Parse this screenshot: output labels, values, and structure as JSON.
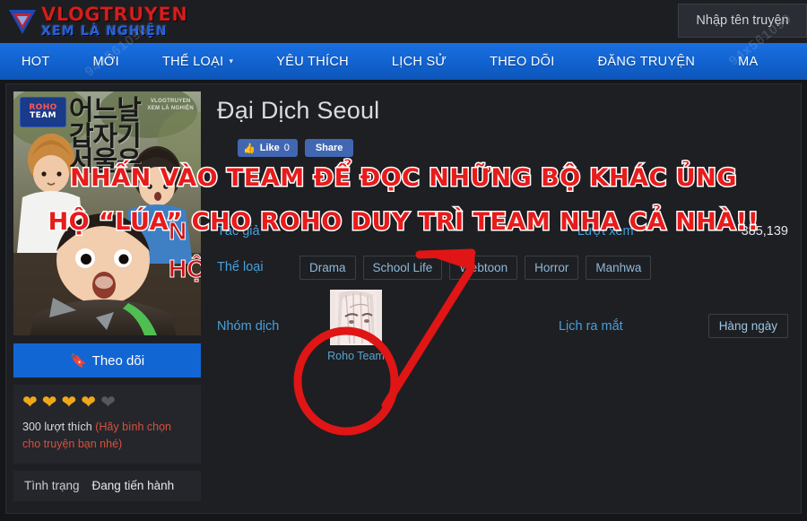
{
  "site": {
    "logo_main": "VLOGTRUYEN",
    "logo_sub": "XEM LÀ NGHIỆN",
    "watermark": "94x561090"
  },
  "search": {
    "placeholder": "Nhập tên truyện",
    "value": ""
  },
  "nav": {
    "items": [
      {
        "label": "HOT",
        "has_caret": false
      },
      {
        "label": "MỚI",
        "has_caret": false
      },
      {
        "label": "THỂ LOẠI",
        "has_caret": true
      },
      {
        "label": "YÊU THÍCH",
        "has_caret": false
      },
      {
        "label": "LỊCH SỬ",
        "has_caret": false
      },
      {
        "label": "THEO DÕI",
        "has_caret": false
      },
      {
        "label": "ĐĂNG TRUYỆN",
        "has_caret": false
      },
      {
        "label": "MA",
        "has_caret": false
      }
    ]
  },
  "cover": {
    "team_badge_line1": "ROHO",
    "team_badge_line2": "TEAM",
    "korean_title": "어느날\n갑자기\n서울은",
    "watermark_line1": "VLOGTRUYEN",
    "watermark_line2": "XEM LÀ NGHIỆN",
    "red_text_line1": "N",
    "red_text_line2": "HỘ"
  },
  "sidebar": {
    "follow_label": "Theo dõi",
    "follow_icon": "bookmark-icon",
    "rating": {
      "filled": 4,
      "total": 5
    },
    "like_count_text": "300 lượt thích",
    "like_hint_text": "(Hãy bình chọn cho truyện bạn nhé)",
    "status_label": "Tình trạng",
    "status_value": "Đang tiến hành"
  },
  "detail": {
    "title": "Đại Dịch Seoul",
    "social": {
      "like_label": "Like",
      "like_count": "0",
      "share_label": "Share"
    },
    "author_label": "Tác giả",
    "author_value": "",
    "views_label": "Lượt xem",
    "views_value": "385,139",
    "genre_label": "Thể loại",
    "genres": [
      "Drama",
      "School Life",
      "Webtoon",
      "Horror",
      "Manhwa"
    ],
    "team_label": "Nhóm dịch",
    "team_name": "Roho Team",
    "schedule_label": "Lịch ra mắt",
    "schedule_value": "Hàng ngày"
  },
  "annotation": {
    "line1": "NHẤN VÀO TEAM ĐỂ ĐỌC NHỮNG BỘ KHÁC ỦNG",
    "line2": "HỘ “LÚA” CHO ROHO DUY TRÌ TEAM NHA CẢ NHÀ!!",
    "color": "#e81b1b",
    "stroke_color": "#ffffff"
  },
  "colors": {
    "nav_blue": "#1162cf",
    "accent_link": "#4a9fd8",
    "bg_dark": "#14161a",
    "panel": "#1d1f23",
    "heart_gold": "#f0a819",
    "hint_red": "#d9503c"
  }
}
